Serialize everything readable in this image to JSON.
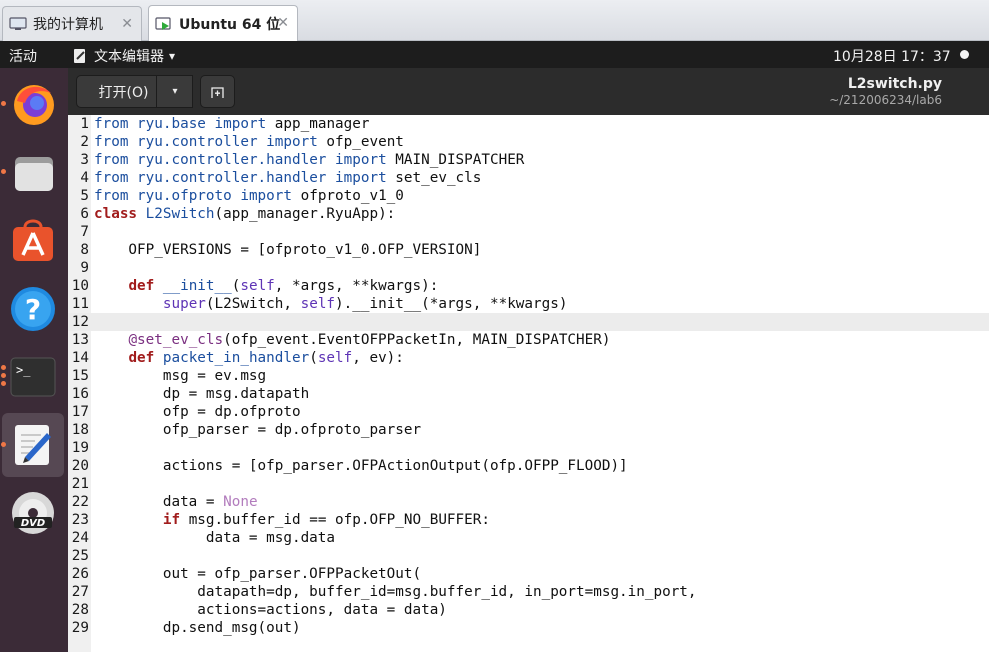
{
  "vm_tabs": [
    {
      "label": "我的计算机",
      "close": "✕"
    },
    {
      "label": "Ubuntu 64 位",
      "close": "✕"
    }
  ],
  "topbar": {
    "activities": "活动",
    "app_menu": "文本编辑器",
    "app_menu_arrow": "▾",
    "clock": "10月28日  17：37"
  },
  "dock": [
    {
      "name": "firefox-icon",
      "running": true
    },
    {
      "name": "files-icon",
      "running": true
    },
    {
      "name": "software-center-icon",
      "running": false
    },
    {
      "name": "help-icon",
      "running": false
    },
    {
      "name": "terminal-icon",
      "running": true
    },
    {
      "name": "text-editor-icon",
      "running": true,
      "selected": true
    },
    {
      "name": "dvd-icon",
      "running": false
    }
  ],
  "headerbar": {
    "open_label": "打开(O)",
    "open_menu_arrow": "▾",
    "title": "L2switch.py",
    "path": "~/212006234/lab6"
  },
  "editor": {
    "current_line": 12,
    "lines": [
      [
        [
          "kw",
          "from"
        ],
        [
          "t",
          " "
        ],
        [
          "kw",
          "ryu.base"
        ],
        [
          "t",
          " "
        ],
        [
          "kw",
          "import"
        ],
        [
          "t",
          " app_manager"
        ]
      ],
      [
        [
          "kw",
          "from"
        ],
        [
          "t",
          " "
        ],
        [
          "kw",
          "ryu.controller"
        ],
        [
          "t",
          " "
        ],
        [
          "kw",
          "import"
        ],
        [
          "t",
          " ofp_event"
        ]
      ],
      [
        [
          "kw",
          "from"
        ],
        [
          "t",
          " "
        ],
        [
          "kw",
          "ryu.controller.handler"
        ],
        [
          "t",
          " "
        ],
        [
          "kw",
          "import"
        ],
        [
          "t",
          " MAIN_DISPATCHER"
        ]
      ],
      [
        [
          "kw",
          "from"
        ],
        [
          "t",
          " "
        ],
        [
          "kw",
          "ryu.controller.handler"
        ],
        [
          "t",
          " "
        ],
        [
          "kw",
          "import"
        ],
        [
          "t",
          " set_ev_cls"
        ]
      ],
      [
        [
          "kw",
          "from"
        ],
        [
          "t",
          " "
        ],
        [
          "kw",
          "ryu.ofproto"
        ],
        [
          "t",
          " "
        ],
        [
          "kw",
          "import"
        ],
        [
          "t",
          " ofproto_v1_0"
        ]
      ],
      [
        [
          "kw2",
          "class"
        ],
        [
          "t",
          " "
        ],
        [
          "fn",
          "L2Switch"
        ],
        [
          "t",
          "(app_manager.RyuApp):"
        ]
      ],
      [
        [
          "t",
          ""
        ]
      ],
      [
        [
          "t",
          "    OFP_VERSIONS = [ofproto_v1_0.OFP_VERSION]"
        ]
      ],
      [
        [
          "t",
          ""
        ]
      ],
      [
        [
          "t",
          "    "
        ],
        [
          "kw2",
          "def"
        ],
        [
          "t",
          " "
        ],
        [
          "fn",
          "__init__"
        ],
        [
          "t",
          "("
        ],
        [
          "bi",
          "self"
        ],
        [
          "t",
          ", *args, **kwargs):"
        ]
      ],
      [
        [
          "t",
          "        "
        ],
        [
          "bi",
          "super"
        ],
        [
          "t",
          "(L2Switch, "
        ],
        [
          "bi",
          "self"
        ],
        [
          "t",
          ").__init__(*args, **kwargs)"
        ]
      ],
      [
        [
          "t",
          ""
        ]
      ],
      [
        [
          "t",
          "    "
        ],
        [
          "dec",
          "@set_ev_cls"
        ],
        [
          "t",
          "(ofp_event.EventOFPPacketIn, MAIN_DISPATCHER)"
        ]
      ],
      [
        [
          "t",
          "    "
        ],
        [
          "kw2",
          "def"
        ],
        [
          "t",
          " "
        ],
        [
          "fn",
          "packet_in_handler"
        ],
        [
          "t",
          "("
        ],
        [
          "bi",
          "self"
        ],
        [
          "t",
          ", ev):"
        ]
      ],
      [
        [
          "t",
          "        msg = ev.msg"
        ]
      ],
      [
        [
          "t",
          "        dp = msg.datapath"
        ]
      ],
      [
        [
          "t",
          "        ofp = dp.ofproto"
        ]
      ],
      [
        [
          "t",
          "        ofp_parser = dp.ofproto_parser"
        ]
      ],
      [
        [
          "t",
          ""
        ]
      ],
      [
        [
          "t",
          "        actions = [ofp_parser.OFPActionOutput(ofp.OFPP_FLOOD)]"
        ]
      ],
      [
        [
          "t",
          ""
        ]
      ],
      [
        [
          "t",
          "        data = "
        ],
        [
          "const",
          "None"
        ]
      ],
      [
        [
          "t",
          "        "
        ],
        [
          "kw2",
          "if"
        ],
        [
          "t",
          " msg.buffer_id == ofp.OFP_NO_BUFFER:"
        ]
      ],
      [
        [
          "t",
          "             data = msg.data"
        ]
      ],
      [
        [
          "t",
          ""
        ]
      ],
      [
        [
          "t",
          "        out = ofp_parser.OFPPacketOut("
        ]
      ],
      [
        [
          "t",
          "            datapath=dp, buffer_id=msg.buffer_id, in_port=msg.in_port,"
        ]
      ],
      [
        [
          "t",
          "            actions=actions, data = data)"
        ]
      ],
      [
        [
          "t",
          "        dp.send_msg(out)"
        ]
      ]
    ]
  }
}
